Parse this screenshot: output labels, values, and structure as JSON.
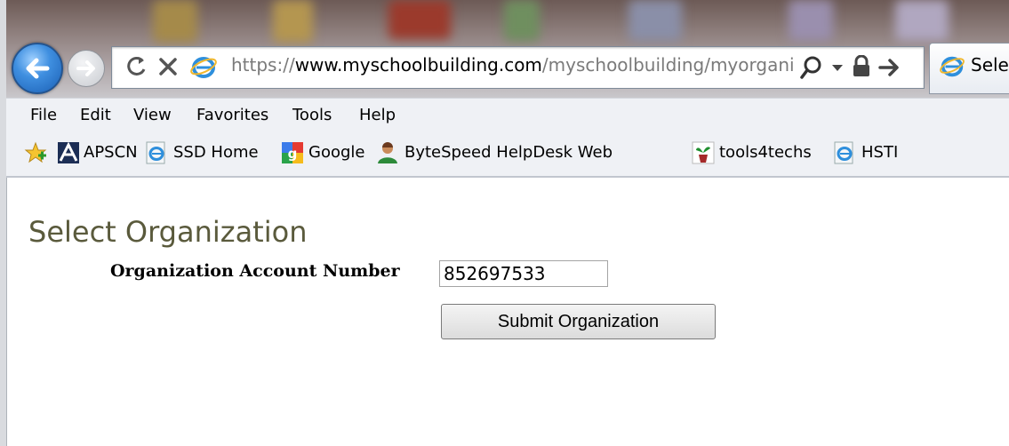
{
  "browser": {
    "url_prefix": "https://",
    "url_domain": "www.myschoolbuilding.com",
    "url_path": "/myschoolbuilding/myorganiza",
    "tab_title": "Sele"
  },
  "menu": {
    "items": [
      "File",
      "Edit",
      "View",
      "Favorites",
      "Tools",
      "Help"
    ]
  },
  "favorites": {
    "items": [
      {
        "label": "APSCN",
        "icon": "apscn-icon"
      },
      {
        "label": "SSD Home",
        "icon": "ie-page-icon"
      },
      {
        "label": "Google",
        "icon": "google-icon"
      },
      {
        "label": "ByteSpeed HelpDesk Web",
        "icon": "helpdesk-person-icon"
      },
      {
        "label": "tools4techs",
        "icon": "plant-icon"
      },
      {
        "label": "HSTI",
        "icon": "ie-page-icon"
      }
    ]
  },
  "page": {
    "title": "Select Organization",
    "account_label": "Organization Account Number",
    "account_value": "852697533",
    "submit_label": "Submit Organization"
  },
  "colors": {
    "title_text": "#5a5a3c",
    "back_button": "#2a73cc",
    "url_domain": "#000000"
  }
}
